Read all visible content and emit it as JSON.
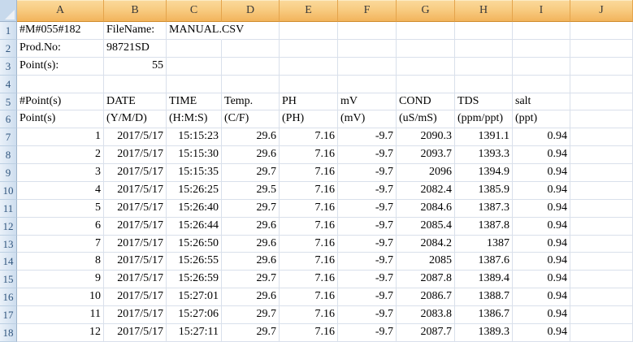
{
  "columns": [
    "A",
    "B",
    "C",
    "D",
    "E",
    "F",
    "G",
    "H",
    "I",
    "J"
  ],
  "rows": [
    {
      "n": "1",
      "cells": [
        "#M#055#182",
        "FileName:",
        "MANUAL.CSV",
        "",
        "",
        "",
        "",
        "",
        "",
        ""
      ]
    },
    {
      "n": "2",
      "cells": [
        "Prod.No:",
        "98721SD",
        "",
        "",
        "",
        "",
        "",
        "",
        "",
        ""
      ]
    },
    {
      "n": "3",
      "cells": [
        "Point(s):",
        "55",
        "",
        "",
        "",
        "",
        "",
        "",
        "",
        ""
      ]
    },
    {
      "n": "4",
      "cells": [
        "",
        "",
        "",
        "",
        "",
        "",
        "",
        "",
        "",
        ""
      ]
    },
    {
      "n": "5",
      "cells": [
        "#Point(s)",
        "DATE",
        "TIME",
        "Temp.",
        "PH",
        "mV",
        "COND",
        "TDS",
        "salt",
        ""
      ]
    },
    {
      "n": "6",
      "cells": [
        "Point(s)",
        "(Y/M/D)",
        "(H:M:S)",
        "(C/F)",
        "(PH)",
        "(mV)",
        "(uS/mS)",
        "(ppm/ppt)",
        "(ppt)",
        ""
      ]
    },
    {
      "n": "7",
      "cells": [
        "1",
        "2017/5/17",
        "15:15:23",
        "29.6",
        "7.16",
        "-9.7",
        "2090.3",
        "1391.1",
        "0.94",
        ""
      ]
    },
    {
      "n": "8",
      "cells": [
        "2",
        "2017/5/17",
        "15:15:30",
        "29.6",
        "7.16",
        "-9.7",
        "2093.7",
        "1393.3",
        "0.94",
        ""
      ]
    },
    {
      "n": "9",
      "cells": [
        "3",
        "2017/5/17",
        "15:15:35",
        "29.7",
        "7.16",
        "-9.7",
        "2096",
        "1394.9",
        "0.94",
        ""
      ]
    },
    {
      "n": "10",
      "cells": [
        "4",
        "2017/5/17",
        "15:26:25",
        "29.5",
        "7.16",
        "-9.7",
        "2082.4",
        "1385.9",
        "0.94",
        ""
      ]
    },
    {
      "n": "11",
      "cells": [
        "5",
        "2017/5/17",
        "15:26:40",
        "29.7",
        "7.16",
        "-9.7",
        "2084.6",
        "1387.3",
        "0.94",
        ""
      ]
    },
    {
      "n": "12",
      "cells": [
        "6",
        "2017/5/17",
        "15:26:44",
        "29.6",
        "7.16",
        "-9.7",
        "2085.4",
        "1387.8",
        "0.94",
        ""
      ]
    },
    {
      "n": "13",
      "cells": [
        "7",
        "2017/5/17",
        "15:26:50",
        "29.6",
        "7.16",
        "-9.7",
        "2084.2",
        "1387",
        "0.94",
        ""
      ]
    },
    {
      "n": "14",
      "cells": [
        "8",
        "2017/5/17",
        "15:26:55",
        "29.6",
        "7.16",
        "-9.7",
        "2085",
        "1387.6",
        "0.94",
        ""
      ]
    },
    {
      "n": "15",
      "cells": [
        "9",
        "2017/5/17",
        "15:26:59",
        "29.7",
        "7.16",
        "-9.7",
        "2087.8",
        "1389.4",
        "0.94",
        ""
      ]
    },
    {
      "n": "16",
      "cells": [
        "10",
        "2017/5/17",
        "15:27:01",
        "29.6",
        "7.16",
        "-9.7",
        "2086.7",
        "1388.7",
        "0.94",
        ""
      ]
    },
    {
      "n": "17",
      "cells": [
        "11",
        "2017/5/17",
        "15:27:06",
        "29.7",
        "7.16",
        "-9.7",
        "2083.8",
        "1386.7",
        "0.94",
        ""
      ]
    },
    {
      "n": "18",
      "cells": [
        "12",
        "2017/5/17",
        "15:27:11",
        "29.7",
        "7.16",
        "-9.7",
        "2087.7",
        "1389.3",
        "0.94",
        ""
      ]
    }
  ],
  "colors": {
    "column_header_top": "#FBDA9C",
    "column_header_bottom": "#F2B45C",
    "column_header_sep": "#E4A44C",
    "column_header_border": "#D08C2E",
    "header_text": "#3A3A3A",
    "row_header_bg_left": "#EAF1F9",
    "row_header_bg_right": "#CDDDEE",
    "row_header_border": "#9FB4CB",
    "row_header_sep": "#BDD0E3",
    "row_number_text": "#31567E",
    "corner_bg": "#C7D9EC",
    "corner_triangle": "#EDF1F6",
    "gridline": "#D9E0EB",
    "cell_text": "#000000"
  }
}
